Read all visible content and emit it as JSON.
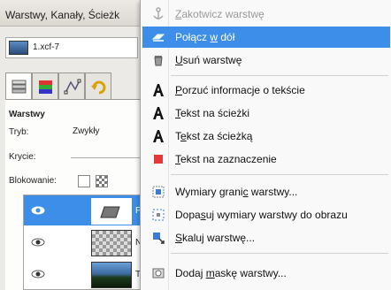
{
  "dock": {
    "title": "Warstwy, Kanały, Ścieżk",
    "image_name": "1.xcf-7",
    "section_label": "Warstwy",
    "mode_label": "Tryb:",
    "mode_value": "Zwykły",
    "opacity_label": "Krycie:",
    "lock_label": "Blokowanie:",
    "layers": [
      {
        "name": "Po",
        "selected": true
      },
      {
        "name": "Nc",
        "selected": false
      },
      {
        "name": "Tł",
        "selected": false
      }
    ]
  },
  "menu": {
    "items": [
      {
        "pre": "",
        "ul": "Z",
        "post": "akotwicz warstwę",
        "icon": "anchor-icon",
        "state": "disabled"
      },
      {
        "pre": "Połącz ",
        "ul": "w",
        "post": " dół",
        "icon": "merge-down-icon",
        "state": "highlighted"
      },
      {
        "pre": "",
        "ul": "U",
        "post": "suń warstwę",
        "icon": "trash-icon",
        "state": "normal"
      },
      {
        "pre": "",
        "ul": "P",
        "post": "orzuć informacje o tekście",
        "icon": "text-a-icon",
        "state": "normal"
      },
      {
        "pre": "",
        "ul": "T",
        "post": "ekst na ścieżki",
        "icon": "text-a-icon",
        "state": "normal"
      },
      {
        "pre": "T",
        "ul": "e",
        "post": "kst za ścieżką",
        "icon": "text-a-icon",
        "state": "normal"
      },
      {
        "pre": "",
        "ul": "T",
        "post": "ekst na zaznaczenie",
        "icon": "red-square-icon",
        "state": "normal"
      },
      {
        "pre": "Wymiary grani",
        "ul": "c",
        "post": " warstwy...",
        "icon": "boundary-size-icon",
        "state": "normal"
      },
      {
        "pre": "Dopa",
        "ul": "s",
        "post": "uj wymiary warstwy do obrazu",
        "icon": "fit-to-image-icon",
        "state": "normal"
      },
      {
        "pre": "",
        "ul": "S",
        "post": "kaluj warstwę...",
        "icon": "scale-layer-icon",
        "state": "normal"
      },
      {
        "pre": "Dodaj ",
        "ul": "m",
        "post": "askę warstwy...",
        "icon": "layer-mask-icon",
        "state": "normal"
      }
    ]
  }
}
